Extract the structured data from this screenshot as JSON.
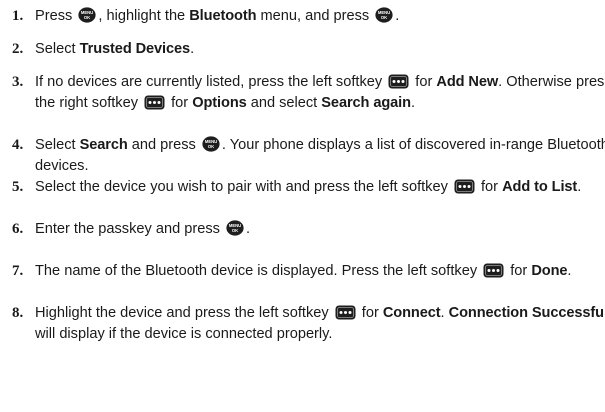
{
  "steps": [
    {
      "number": "1.",
      "parts": [
        {
          "t": "text",
          "v": "Press "
        },
        {
          "t": "icon",
          "name": "menu-ok-key-icon",
          "kind": "menuok"
        },
        {
          "t": "text",
          "v": ", highlight the "
        },
        {
          "t": "bold",
          "v": "Bluetooth"
        },
        {
          "t": "text",
          "v": " menu, and press "
        },
        {
          "t": "icon",
          "name": "menu-ok-key-icon",
          "kind": "menuok"
        },
        {
          "t": "text",
          "v": "."
        }
      ]
    },
    {
      "number": "2.",
      "parts": [
        {
          "t": "text",
          "v": "Select "
        },
        {
          "t": "bold",
          "v": "Trusted Devices"
        },
        {
          "t": "text",
          "v": "."
        }
      ]
    },
    {
      "number": "3.",
      "parts": [
        {
          "t": "text",
          "v": "If no devices are currently listed, press the left softkey "
        },
        {
          "t": "icon",
          "name": "softkey-icon",
          "kind": "softkey"
        },
        {
          "t": "text",
          "v": " for "
        },
        {
          "t": "bold",
          "v": "Add New"
        },
        {
          "t": "text",
          "v": ". Otherwise press the right softkey "
        },
        {
          "t": "icon",
          "name": "softkey-icon",
          "kind": "softkey"
        },
        {
          "t": "text",
          "v": " for "
        },
        {
          "t": "bold",
          "v": "Options"
        },
        {
          "t": "text",
          "v": " and select "
        },
        {
          "t": "bold",
          "v": "Search again"
        },
        {
          "t": "text",
          "v": "."
        }
      ]
    },
    {
      "number": "4.",
      "parts": [
        {
          "t": "text",
          "v": "Select "
        },
        {
          "t": "bold",
          "v": "Search"
        },
        {
          "t": "text",
          "v": " and press "
        },
        {
          "t": "icon",
          "name": "menu-ok-key-icon",
          "kind": "menuok"
        },
        {
          "t": "text",
          "v": ". Your phone displays a list of discovered in-range Bluetooth devices."
        }
      ]
    },
    {
      "number": "5.",
      "parts": [
        {
          "t": "text",
          "v": "Select the device you wish to pair with and press the left softkey "
        },
        {
          "t": "icon",
          "name": "softkey-icon",
          "kind": "softkey"
        },
        {
          "t": "text",
          "v": " for "
        },
        {
          "t": "bold",
          "v": "Add to List"
        },
        {
          "t": "text",
          "v": "."
        }
      ]
    },
    {
      "number": "6.",
      "parts": [
        {
          "t": "text",
          "v": "Enter the passkey and press "
        },
        {
          "t": "icon",
          "name": "menu-ok-key-icon",
          "kind": "menuok"
        },
        {
          "t": "text",
          "v": "."
        }
      ]
    },
    {
      "number": "7.",
      "parts": [
        {
          "t": "text",
          "v": "The name of the Bluetooth device is displayed. Press the left softkey "
        },
        {
          "t": "icon",
          "name": "softkey-icon",
          "kind": "softkey"
        },
        {
          "t": "text",
          "v": " for "
        },
        {
          "t": "bold",
          "v": "Done"
        },
        {
          "t": "text",
          "v": "."
        }
      ]
    },
    {
      "number": "8.",
      "parts": [
        {
          "t": "text",
          "v": "Highlight the device and press the left softkey "
        },
        {
          "t": "icon",
          "name": "softkey-icon",
          "kind": "softkey"
        },
        {
          "t": "text",
          "v": " for "
        },
        {
          "t": "bold",
          "v": "Connect"
        },
        {
          "t": "text",
          "v": ". "
        },
        {
          "t": "bold",
          "v": "Connection Successful"
        },
        {
          "t": "text",
          "v": " will display if the device is connected properly."
        }
      ]
    }
  ],
  "icons": {
    "menuok": {
      "top": "MENU",
      "bottom": "OK"
    }
  }
}
